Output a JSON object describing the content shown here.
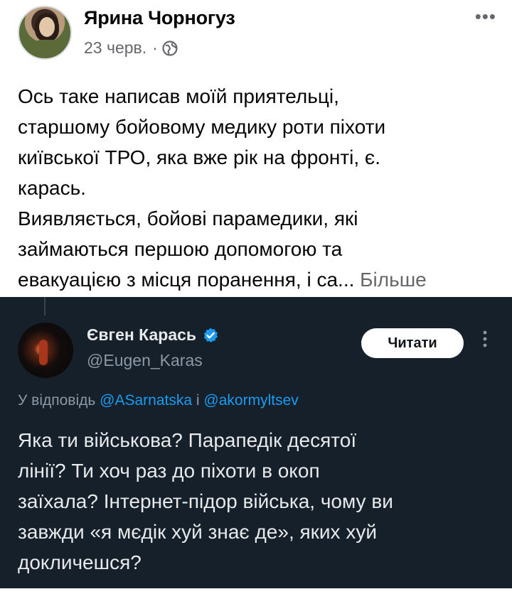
{
  "post": {
    "author": "Ярина Чорногуз",
    "date": "23 черв.",
    "separator": "·",
    "privacy_icon": "globe-icon",
    "more_label": "•••",
    "text_lines": [
      "Ось таке написав моїй приятельці,",
      "старшому бойовому медику роти піхоти",
      "київської ТРО, яка вже рік на фронті, є.",
      "карась.",
      "Виявляється, бойові парамедики, які",
      "займаються першою допомогою та",
      "евакуацією з місця поранення, і са..."
    ],
    "see_more": "Більше"
  },
  "tweet": {
    "display_name": "Євген Карась",
    "verified_icon": "verified-badge-icon",
    "handle": "@Eugen_Karas",
    "follow_label": "Читати",
    "reply_prefix": "У відповідь",
    "mention_1": "@ASarnatska",
    "reply_joiner": "і",
    "mention_2": "@akormyltsev",
    "text_lines": [
      "Яка ти військова? Парапедік десятої",
      "лінії? Ти хоч раз до піхоти в окоп",
      "заїхала? Інтернет-підор війська, чому ви",
      "завжди «я мєдік хуй знає де», яких хуй",
      "докличешся?"
    ]
  },
  "colors": {
    "fb_text": "#050505",
    "fb_secondary": "#65676b",
    "tweet_bg": "#15202b",
    "tweet_text": "#e7e9ea",
    "tweet_secondary": "#8b98a5",
    "mention": "#1d9bf0"
  }
}
